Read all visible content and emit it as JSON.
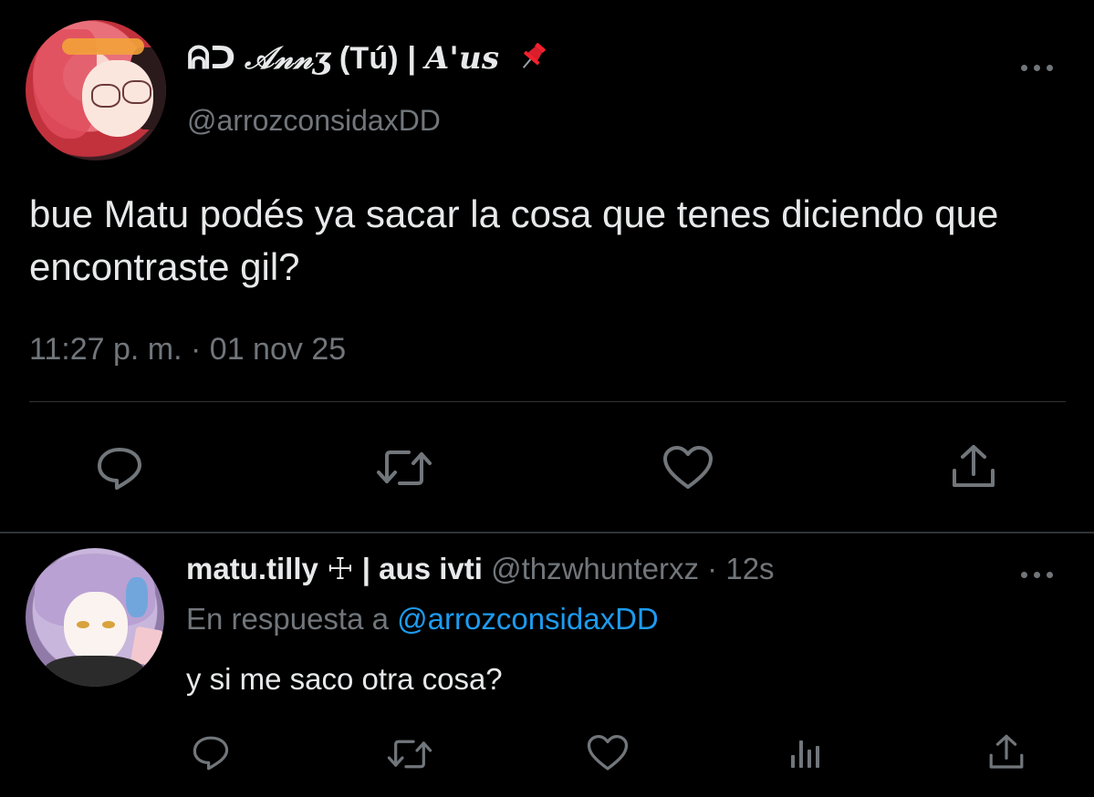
{
  "main_tweet": {
    "display_name_prefix": "ᕱᑐ",
    "display_name_script": "𝒜𝓃𝓃ʒ",
    "display_name_rest": " (Tú) | ",
    "display_name_aus": "A'us",
    "handle": "@arrozconsidaxDD",
    "text": "bue Matu podés ya sacar la cosa que tenes diciendo que encontraste gil?",
    "timestamp": "11:27 p. m. · 01 nov 25",
    "actions": [
      "reply-icon",
      "retweet-icon",
      "like-icon",
      "share-icon"
    ]
  },
  "reply_tweet": {
    "display_name": "matu.tilly ☩ | aus ivti",
    "handle": "@thzwhunterxz",
    "time": " · 12s",
    "reply_prefix": "En respuesta a ",
    "reply_to_handle": "@arrozconsidaxDD",
    "text": "y si me saco otra cosa?",
    "actions": [
      "reply-icon",
      "retweet-icon",
      "like-icon",
      "views-icon",
      "share-icon"
    ]
  },
  "colors": {
    "background": "#000000",
    "text_primary": "#e7e9ea",
    "text_secondary": "#71767b",
    "link": "#1d9bf0",
    "divider": "#2f3336",
    "pin": "#f4212e"
  }
}
